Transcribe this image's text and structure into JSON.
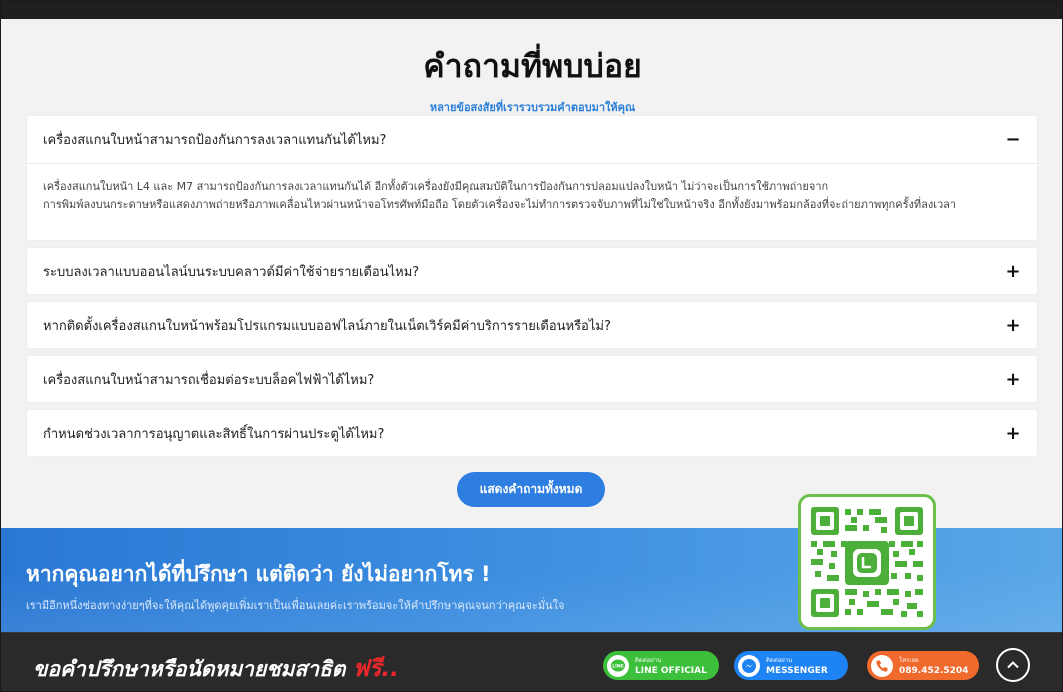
{
  "faq": {
    "title": "คำถามที่พบบ่อย",
    "subtitle": "หลายข้อสงสัยที่เรารวบรวมคำตอบมาให้คุณ",
    "items": [
      {
        "question": "เครื่องสแกนใบหน้าสามารถป้องกันการลงเวลาแทนกันได้ไหม?",
        "toggle": "−",
        "open": true,
        "answer_lines": [
          "เครื่องสแกนใบหน้า L4 และ M7 สามารถป้องกันการลงเวลาแทนกันได้ อีกทั้งตัวเครื่องยังมีคุณสมบัติในการป้องกันการปลอมแปลงใบหน้า ไม่ว่าจะเป็นการใช้ภาพถ่ายจาก",
          "การพิมพ์ลงบนกระดาษหรือแสดงภาพถ่ายหรือภาพเคลื่อนไหวผ่านหน้าจอโทรศัพท์มือถือ โดยตัวเครื่องจะไม่ทำการตรวจจับภาพที่ไม่ใช่ใบหน้าจริง อีกทั้งยังมาพร้อมกล้องที่จะถ่ายภาพทุกครั้งที่ลงเวลา"
        ]
      },
      {
        "question": "ระบบลงเวลาแบบออนไลน์บนระบบคลาวด์มีค่าใช้จ่ายรายเดือนไหม?",
        "toggle": "+"
      },
      {
        "question": "หากติดตั้งเครื่องสแกนใบหน้าพร้อมโปรแกรมแบบออฟไลน์ภายในเน็ตเวิร์คมีค่าบริการรายเดือนหรือไม่?",
        "toggle": "+"
      },
      {
        "question": "เครื่องสแกนใบหน้าสามารถเชื่อมต่อระบบล็อคไฟฟ้าได้ไหม?",
        "toggle": "+"
      },
      {
        "question": "กำหนดช่วงเวลาการอนุญาตและสิทธิ์ในการผ่านประตูได้ไหม?",
        "toggle": "+"
      }
    ],
    "show_all_label": "แสดงคำถามทั้งหมด"
  },
  "contact": {
    "title": "หากคุณอยากได้ที่ปรึกษา แต่ติดว่า ยังไม่อยากโทร !",
    "subtitle": "เรามีอีกหนึ่งช่องทางง่ายๆที่จะให้คุณได้พูดคุยเพิ่มเราเป็นเพื่อนเลยค่ะเราพร้อมจะให้คำปรึกษาคุณจนกว่าคุณจะมั่นใจ",
    "qr_icon": "line-qr-code"
  },
  "bottom_bar": {
    "cta_text": "ขอคำปรึกษาหรือนัดหมายชมสาธิต",
    "cta_free": "ฟรี..",
    "line": {
      "small": "ติดต่อผ่าน",
      "big": "LINE OFFICIAL",
      "icon": "line-icon"
    },
    "messenger": {
      "small": "ติดต่อผ่าน",
      "big": "MESSENGER",
      "icon": "messenger-icon"
    },
    "phone": {
      "small": "โทรเลย",
      "big": "089.452.5204",
      "icon": "phone-icon"
    },
    "up_icon": "chevron-up-icon"
  },
  "colors": {
    "accent_blue": "#2d7ee0",
    "line_green": "#3cc03c",
    "messenger_blue": "#1e83f3",
    "phone_orange": "#ef6a2c",
    "free_red": "#e8282b"
  }
}
